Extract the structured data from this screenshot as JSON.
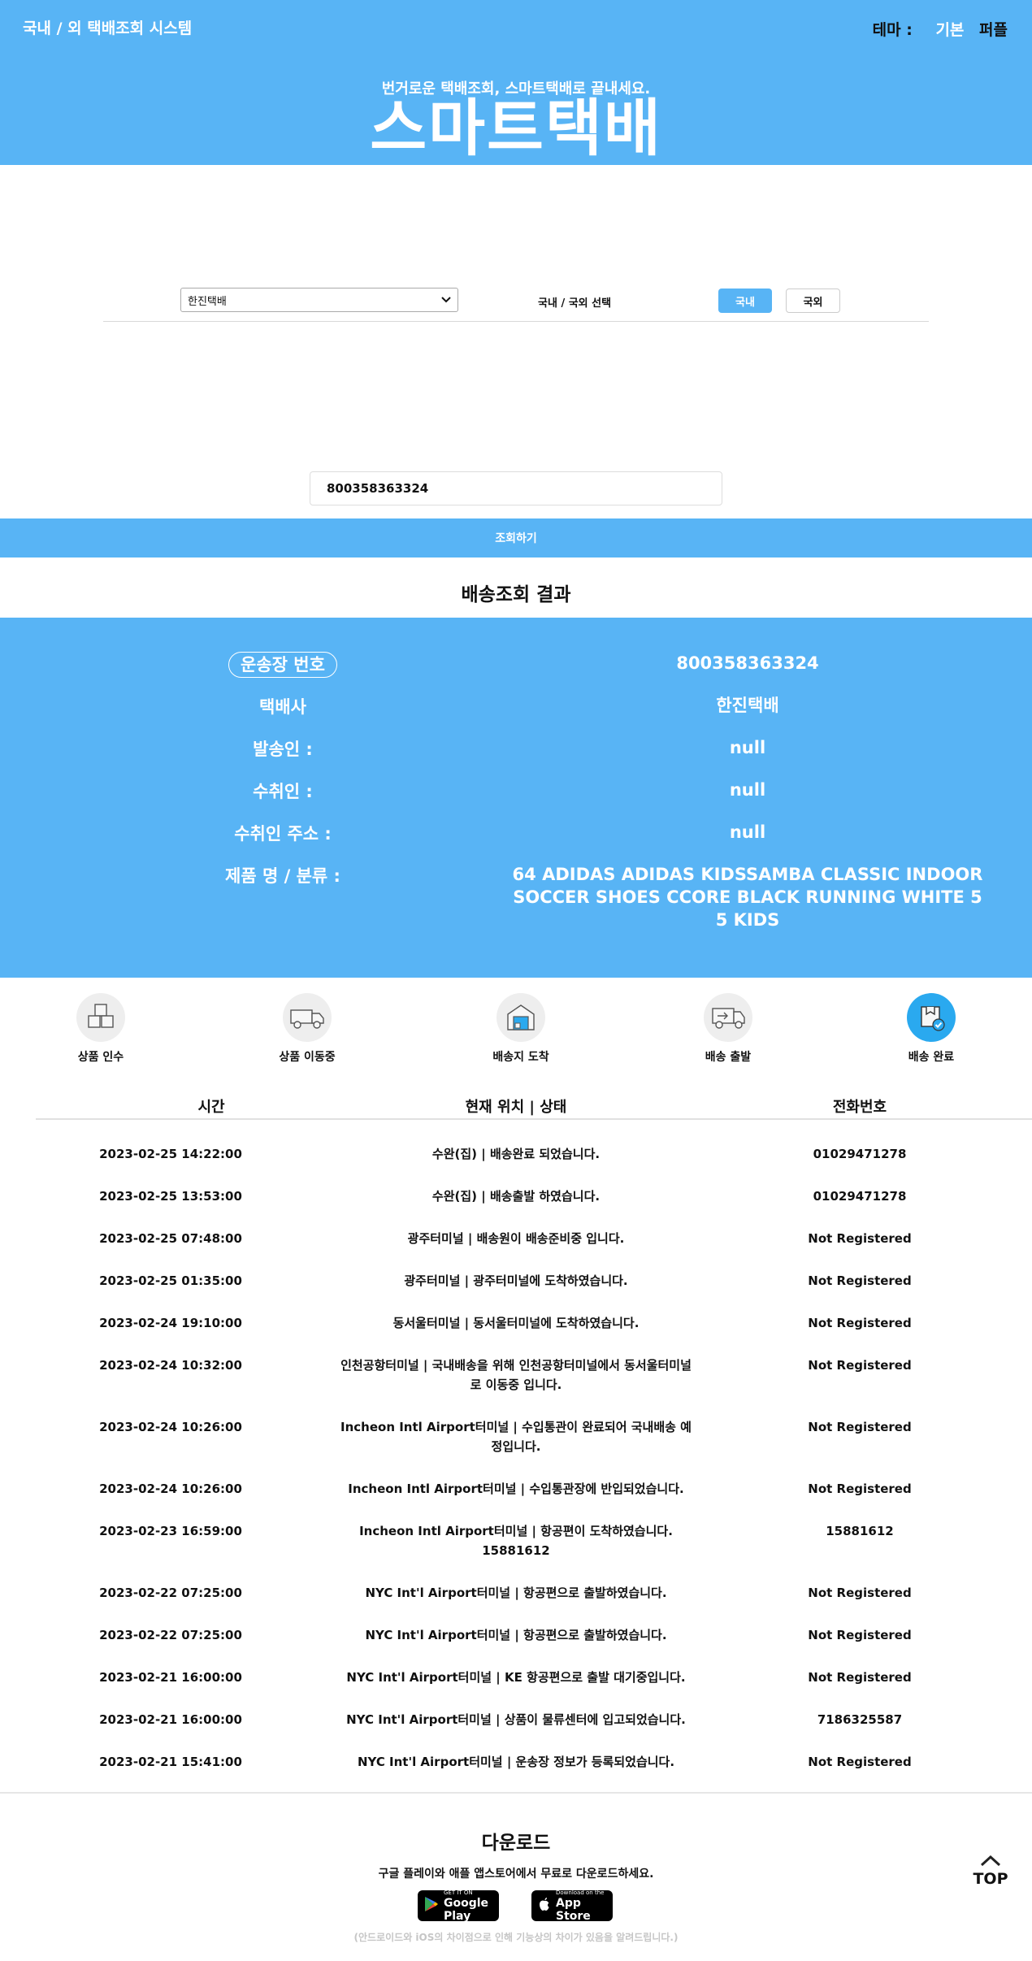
{
  "header": {
    "system_title": "국내 / 외 택배조회 시스템",
    "theme_label": "테마 :",
    "theme_options": [
      "기본",
      "퍼플"
    ],
    "slogan": "번거로운 택배조회, 스마트택배로 끝내세요.",
    "logo_text": "스마트택배"
  },
  "selector": {
    "courier_selected": "한진택배",
    "region_label": "국내 / 국외 선택",
    "domestic_label": "국내",
    "international_label": "국외"
  },
  "search": {
    "tracking_number": "800358363324",
    "button_label": "조회하기"
  },
  "result": {
    "title": "배송조회 결과",
    "rows": [
      {
        "key": "운송장 번호",
        "value": "800358363324"
      },
      {
        "key": "택배사",
        "value": "한진택배"
      },
      {
        "key": "발송인 :",
        "value": "null"
      },
      {
        "key": "수취인 :",
        "value": "null"
      },
      {
        "key": "수취인 주소 :",
        "value": "null"
      },
      {
        "key": "제품 명 / 분류 :",
        "value": "64 ADIDAS ADIDAS KIDSSAMBA CLASSIC INDOOR SOCCER SHOES CCORE BLACK RUNNING WHITE 5 5 KIDS"
      }
    ]
  },
  "steps": [
    {
      "label": "상품 인수",
      "icon": "boxes-icon",
      "done": false
    },
    {
      "label": "상품 이동중",
      "icon": "truck-icon",
      "done": false
    },
    {
      "label": "배송지 도착",
      "icon": "warehouse-icon",
      "done": false
    },
    {
      "label": "배송 출발",
      "icon": "delivery-van-icon",
      "done": false
    },
    {
      "label": "배송 완료",
      "icon": "box-check-icon",
      "done": true
    }
  ],
  "table": {
    "headers": [
      "시간",
      "현재 위치 | 상태",
      "전화번호"
    ],
    "rows": [
      {
        "time": "2023-02-25 14:22:00",
        "status": "수완(집) | 배송완료 되었습니다.",
        "phone": "01029471278"
      },
      {
        "time": "2023-02-25 13:53:00",
        "status": "수완(집) | 배송출발 하였습니다.",
        "phone": "01029471278"
      },
      {
        "time": "2023-02-25 07:48:00",
        "status": "광주터미널 | 배송원이 배송준비중 입니다.",
        "phone": "Not Registered"
      },
      {
        "time": "2023-02-25 01:35:00",
        "status": "광주터미널 | 광주터미널에 도착하였습니다.",
        "phone": "Not Registered"
      },
      {
        "time": "2023-02-24 19:10:00",
        "status": "동서울터미널 | 동서울터미널에 도착하였습니다.",
        "phone": "Not Registered"
      },
      {
        "time": "2023-02-24 10:32:00",
        "status": "인천공항터미널 | 국내배송을 위해 인천공항터미널에서 동서울터미널로 이동중 입니다.",
        "phone": "Not Registered"
      },
      {
        "time": "2023-02-24 10:26:00",
        "status": "Incheon Intl Airport터미널 | 수입통관이 완료되어 국내배송 예정입니다.",
        "phone": "Not Registered"
      },
      {
        "time": "2023-02-24 10:26:00",
        "status": "Incheon Intl Airport터미널 | 수입통관장에 반입되었습니다.",
        "phone": "Not Registered"
      },
      {
        "time": "2023-02-23 16:59:00",
        "status": "Incheon Intl Airport터미널 | 항공편이 도착하였습니다. 15881612",
        "phone": "15881612"
      },
      {
        "time": "2023-02-22 07:25:00",
        "status": "NYC Int'l Airport터미널 | 항공편으로 출발하였습니다.",
        "phone": "Not Registered"
      },
      {
        "time": "2023-02-22 07:25:00",
        "status": "NYC Int'l Airport터미널 | 항공편으로 출발하였습니다.",
        "phone": "Not Registered"
      },
      {
        "time": "2023-02-21 16:00:00",
        "status": "NYC Int'l Airport터미널 | KE 항공편으로 출발 대기중입니다.",
        "phone": "Not Registered"
      },
      {
        "time": "2023-02-21 16:00:00",
        "status": "NYC Int'l Airport터미널 | 상품이 물류센터에 입고되었습니다.",
        "phone": "7186325587"
      },
      {
        "time": "2023-02-21 15:41:00",
        "status": "NYC Int'l Airport터미널 | 운송장 정보가 등록되었습니다.",
        "phone": "Not Registered"
      }
    ]
  },
  "footer": {
    "download_title": "다운로드",
    "download_desc": "구글 플레이와 애플 앱스토어에서 무료로 다운로드하세요.",
    "google_small": "GET IT ON",
    "google_big": "Google Play",
    "apple_small": "Download on the",
    "apple_big": "App Store",
    "note": "(안드로이드와 iOS의 차이점으로 인해 기능상의 차이가 있음을 알려드립니다.)",
    "top_label": "TOP"
  },
  "colors": {
    "primary": "#58b4f5",
    "step_done": "#2aa9ef",
    "step_idle": "#eeeeee"
  }
}
